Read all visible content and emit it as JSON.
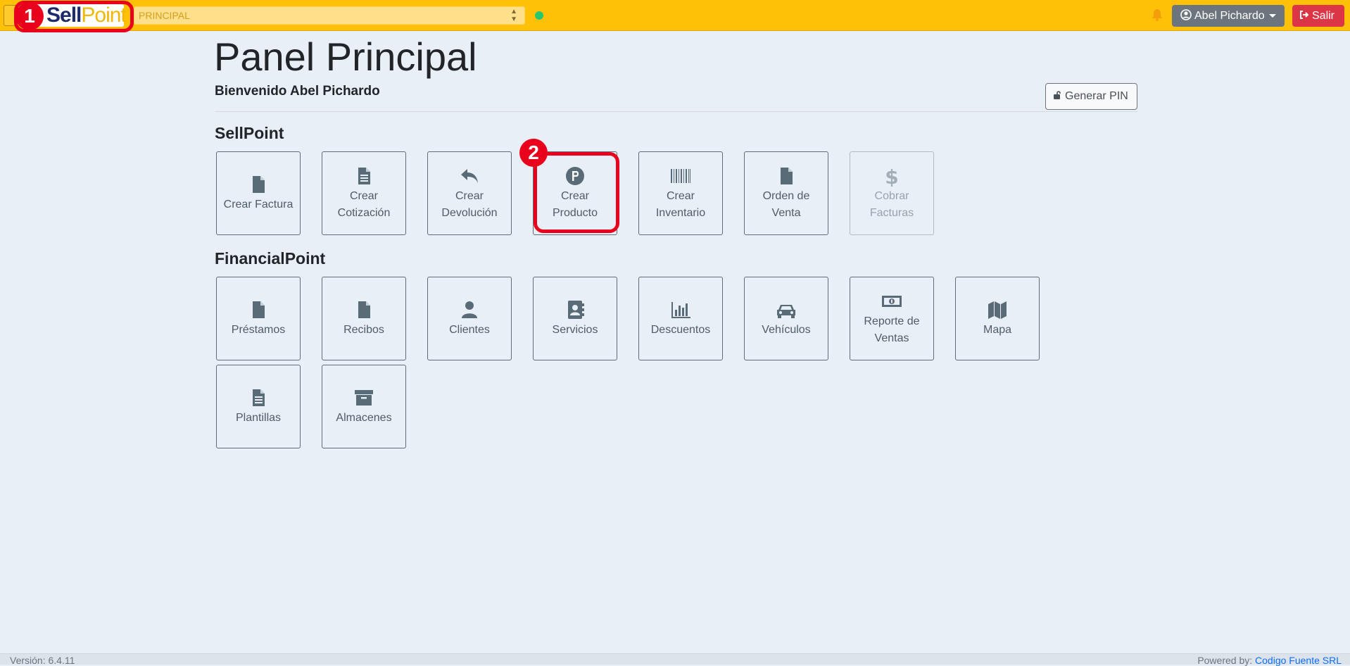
{
  "topbar": {
    "logo_sell": "Sell",
    "logo_point": "Point",
    "branch_value": "PRINCIPAL",
    "user_name": "Abel Pichardo",
    "logout_label": "Salir"
  },
  "markers": [
    "1",
    "2"
  ],
  "page": {
    "title": "Panel Principal",
    "welcome": "Bienvenido Abel Pichardo",
    "pin_button": "Generar PIN"
  },
  "sections": {
    "sellpoint": {
      "title": "SellPoint",
      "tiles": [
        {
          "label": "Crear Factura",
          "icon": "file-icon"
        },
        {
          "label": "Crear Cotización",
          "icon": "file-text-icon"
        },
        {
          "label": "Crear Devolución",
          "icon": "reply-icon"
        },
        {
          "label": "Crear Producto",
          "icon": "product-p-icon"
        },
        {
          "label": "Crear Inventario",
          "icon": "barcode-icon"
        },
        {
          "label": "Orden de Venta",
          "icon": "file-icon"
        },
        {
          "label": "Cobrar Facturas",
          "icon": "dollar-icon",
          "disabled": true
        }
      ]
    },
    "financialpoint": {
      "title": "FinancialPoint",
      "tiles": [
        {
          "label": "Préstamos",
          "icon": "file-icon"
        },
        {
          "label": "Recibos",
          "icon": "file-icon"
        },
        {
          "label": "Clientes",
          "icon": "user-icon"
        },
        {
          "label": "Servicios",
          "icon": "address-book-icon"
        },
        {
          "label": "Descuentos",
          "icon": "bar-chart-icon"
        },
        {
          "label": "Vehículos",
          "icon": "car-icon"
        },
        {
          "label": "Reporte de Ventas",
          "icon": "money-bill-icon"
        },
        {
          "label": "Mapa",
          "icon": "map-icon"
        },
        {
          "label": "Plantillas",
          "icon": "file-text-icon"
        },
        {
          "label": "Almacenes",
          "icon": "archive-icon"
        }
      ]
    }
  },
  "footer": {
    "version": "Versión: 6.4.11",
    "powered_prefix": "Powered by:",
    "powered_link": "Codigo Fuente SRL"
  },
  "colors": {
    "topbar": "#ffc107",
    "logout": "#dc3545",
    "user_button": "#6c757d",
    "annotation": "#e8001c",
    "tile_text": "#4f5b66"
  }
}
